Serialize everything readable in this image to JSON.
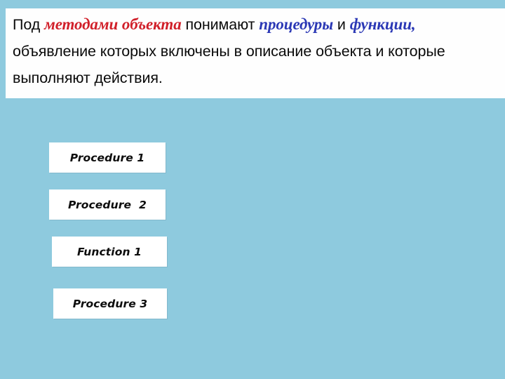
{
  "slide": {
    "background_color": "#8ecade",
    "definition": {
      "segments": [
        {
          "text": "Под ",
          "style": "plain"
        },
        {
          "text": "методами объекта",
          "style": "emphasis-red"
        },
        {
          "text": " понимают ",
          "style": "plain"
        },
        {
          "text": "процедуры",
          "style": "emphasis-blue"
        },
        {
          "text": " и ",
          "style": "plain"
        },
        {
          "text": "функции,",
          "style": "emphasis-blue"
        },
        {
          "text": " объявление которых включены в описание объекта и которые выполняют действия.",
          "style": "plain"
        }
      ],
      "full_text": "Под методами объекта понимают процедуры и функции, объявление которых включены в описание объекта и которые выполняют действия.",
      "part_1": "Под ",
      "part_2": "методами объекта",
      "part_3": " понимают ",
      "part_4": "процедуры",
      "part_5": " и ",
      "part_6": "функции,",
      "part_7": " объявление которых включены в описание объекта и которые выполняют действия.",
      "emphasis_red_color": "#d1202a",
      "emphasis_blue_color": "#2b38b5",
      "background_color": "#fefefe",
      "text_color": "#0a0a0a"
    },
    "method_boxes": [
      {
        "label": "Procedure 1"
      },
      {
        "label": "Procedure  2"
      },
      {
        "label": "Function 1"
      },
      {
        "label": "Procedure 3"
      }
    ]
  }
}
